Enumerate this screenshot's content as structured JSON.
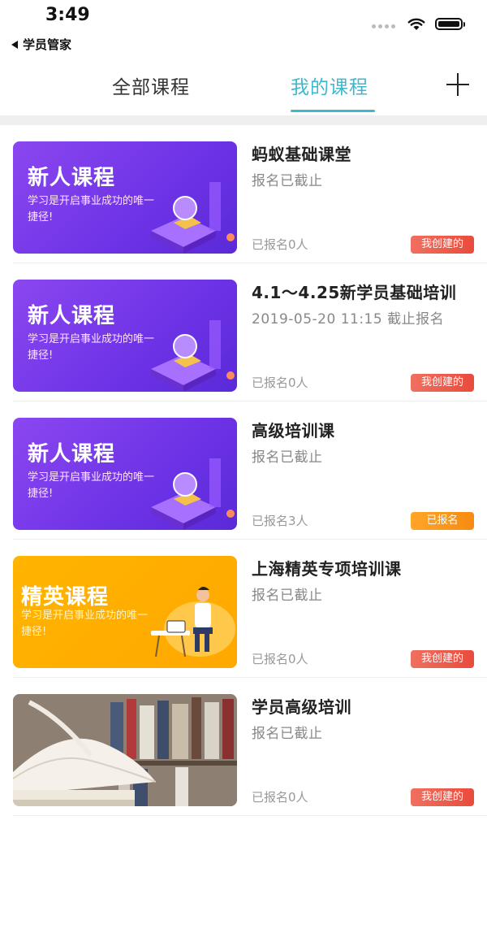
{
  "status_bar": {
    "time": "3:49",
    "back_app": "学员管家"
  },
  "tabs": [
    {
      "label": "全部课程",
      "active": false
    },
    {
      "label": "我的课程",
      "active": true
    }
  ],
  "add_icon": "plus-icon",
  "colors": {
    "accent": "#3db8cf",
    "badge_red": "#e94b3c",
    "badge_gold": "#f68b10"
  },
  "courses": [
    {
      "thumb": {
        "style": "purple",
        "title": "新人课程",
        "subtitle": "学习是开启事业成功的唯一捷径!"
      },
      "title": "蚂蚁基础课堂",
      "status": "报名已截止",
      "enrolled": "已报名0人",
      "badge": "我创建的"
    },
    {
      "thumb": {
        "style": "purple",
        "title": "新人课程",
        "subtitle": "学习是开启事业成功的唯一捷径!"
      },
      "title": "4.1～4.25新学员基础培训",
      "status": "2019-05-20 11:15 截止报名",
      "enrolled": "已报名0人",
      "badge": "我创建的"
    },
    {
      "thumb": {
        "style": "purple",
        "title": "新人课程",
        "subtitle": "学习是开启事业成功的唯一捷径!"
      },
      "title": "高级培训课",
      "status": "报名已截止",
      "enrolled": "已报名3人",
      "badge": "已报名"
    },
    {
      "thumb": {
        "style": "orange",
        "title": "精英课程",
        "subtitle": "学习是开启事业成功的唯一捷径!"
      },
      "title": "上海精英专项培训课",
      "status": "报名已截止",
      "enrolled": "已报名0人",
      "badge": "我创建的"
    },
    {
      "thumb": {
        "style": "photo",
        "title": "",
        "subtitle": ""
      },
      "title": "学员高级培训",
      "status": "报名已截止",
      "enrolled": "已报名0人",
      "badge": "我创建的"
    }
  ]
}
